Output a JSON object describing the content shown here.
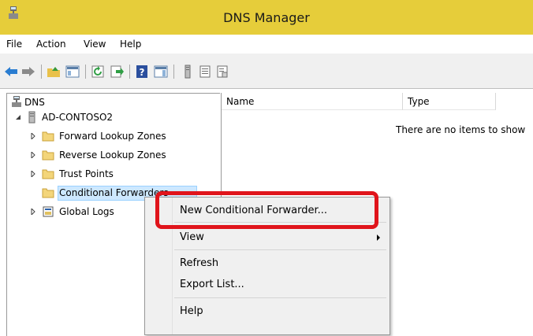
{
  "window": {
    "title": "DNS Manager"
  },
  "menu": [
    "File",
    "Action",
    "View",
    "Help"
  ],
  "tree": {
    "root": "DNS",
    "server": "AD-CONTOSO2",
    "children": [
      "Forward Lookup Zones",
      "Reverse Lookup Zones",
      "Trust Points",
      "Conditional Forwarders",
      "Global Logs"
    ]
  },
  "list": {
    "columns": [
      "Name",
      "Type"
    ],
    "empty_message": "There are no items to show"
  },
  "context_menu": {
    "items": [
      "New Conditional Forwarder...",
      "View",
      "Refresh",
      "Export List...",
      "Help"
    ]
  },
  "colors": {
    "titlebar": "#e6cd3a",
    "highlight": "#e0141b",
    "selection": "#cde8ff"
  }
}
